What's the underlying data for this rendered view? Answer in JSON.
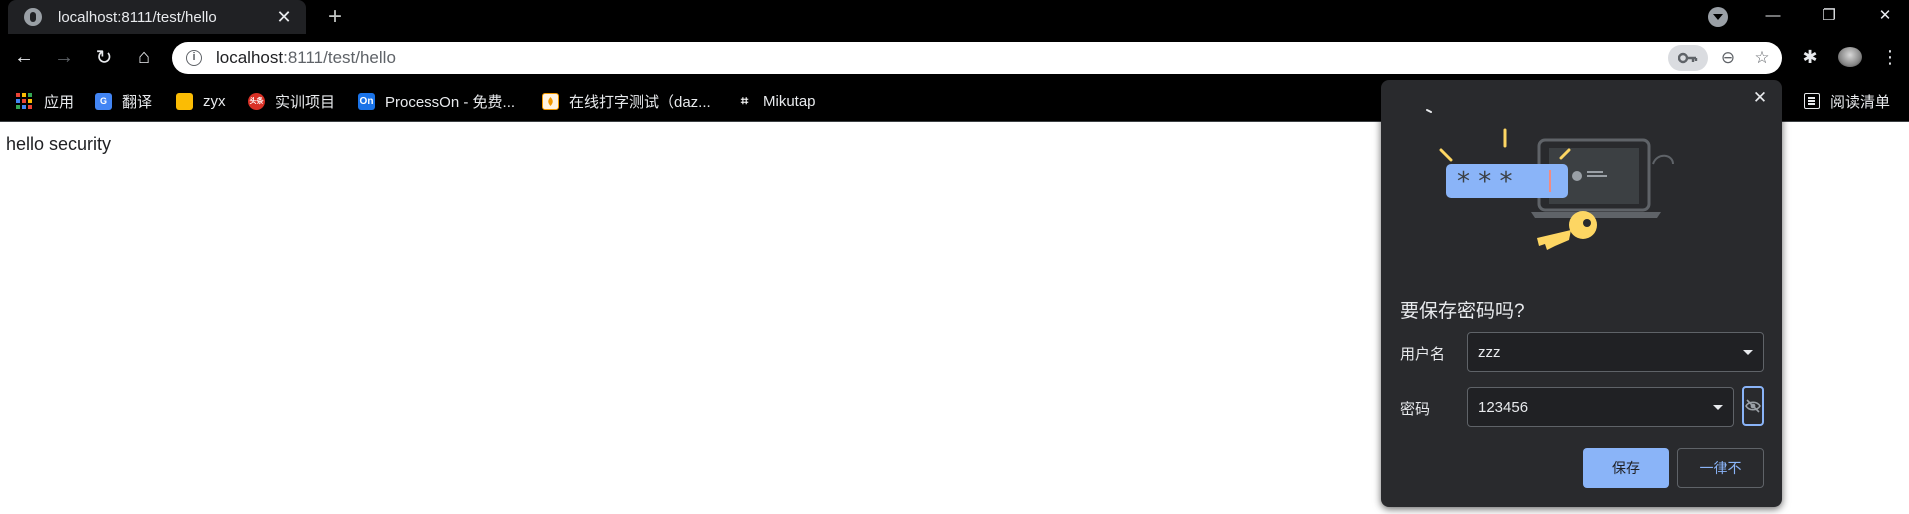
{
  "tab": {
    "title": "localhost:8111/test/hello",
    "close_glyph": "✕",
    "favicon": "globe-icon"
  },
  "tabstrip": {
    "new_tab_glyph": "+",
    "window_minimize_glyph": "—",
    "window_restore_glyph": "❐",
    "window_close_glyph": "✕"
  },
  "toolbar": {
    "back_glyph": "←",
    "forward_glyph": "→",
    "reload_glyph": "↻",
    "home_glyph": "⌂",
    "extensions_glyph": "✱",
    "menu_glyph": "⋮"
  },
  "omnibox": {
    "url_host": "localhost",
    "url_rest": ":8111/test/hello",
    "info_glyph": "i",
    "zoom_glyph": "⊖",
    "star_glyph": "☆"
  },
  "bookmarks": [
    {
      "label": "应用",
      "icon": "apps-grid-icon"
    },
    {
      "label": "翻译",
      "icon": "translate-icon",
      "color": "#4285f4"
    },
    {
      "label": "zyx",
      "icon": "folder-icon",
      "color": "#fbbc04"
    },
    {
      "label": "实训项目",
      "icon": "headline-icon",
      "color": "#d93025",
      "icon_text": "头条"
    },
    {
      "label": "ProcessOn - 免费...",
      "icon": "processon-icon",
      "color": "#1a73e8",
      "icon_text": "On"
    },
    {
      "label": "在线打字测试（daz...",
      "icon": "typing-icon",
      "color": "#f29900"
    },
    {
      "label": "Mikutap",
      "icon": "mikutap-icon",
      "icon_text": "⌗"
    }
  ],
  "reading_list": {
    "label": "阅读清单"
  },
  "page": {
    "body_text": "hello security"
  },
  "save_password": {
    "title": "要保存密码吗?",
    "username_label": "用户名",
    "username_value": "zzz",
    "password_label": "密码",
    "password_value": "123456",
    "save_button": "保存",
    "never_button": "一律不",
    "close_glyph": "✕",
    "accent_color": "#8ab4f8"
  }
}
